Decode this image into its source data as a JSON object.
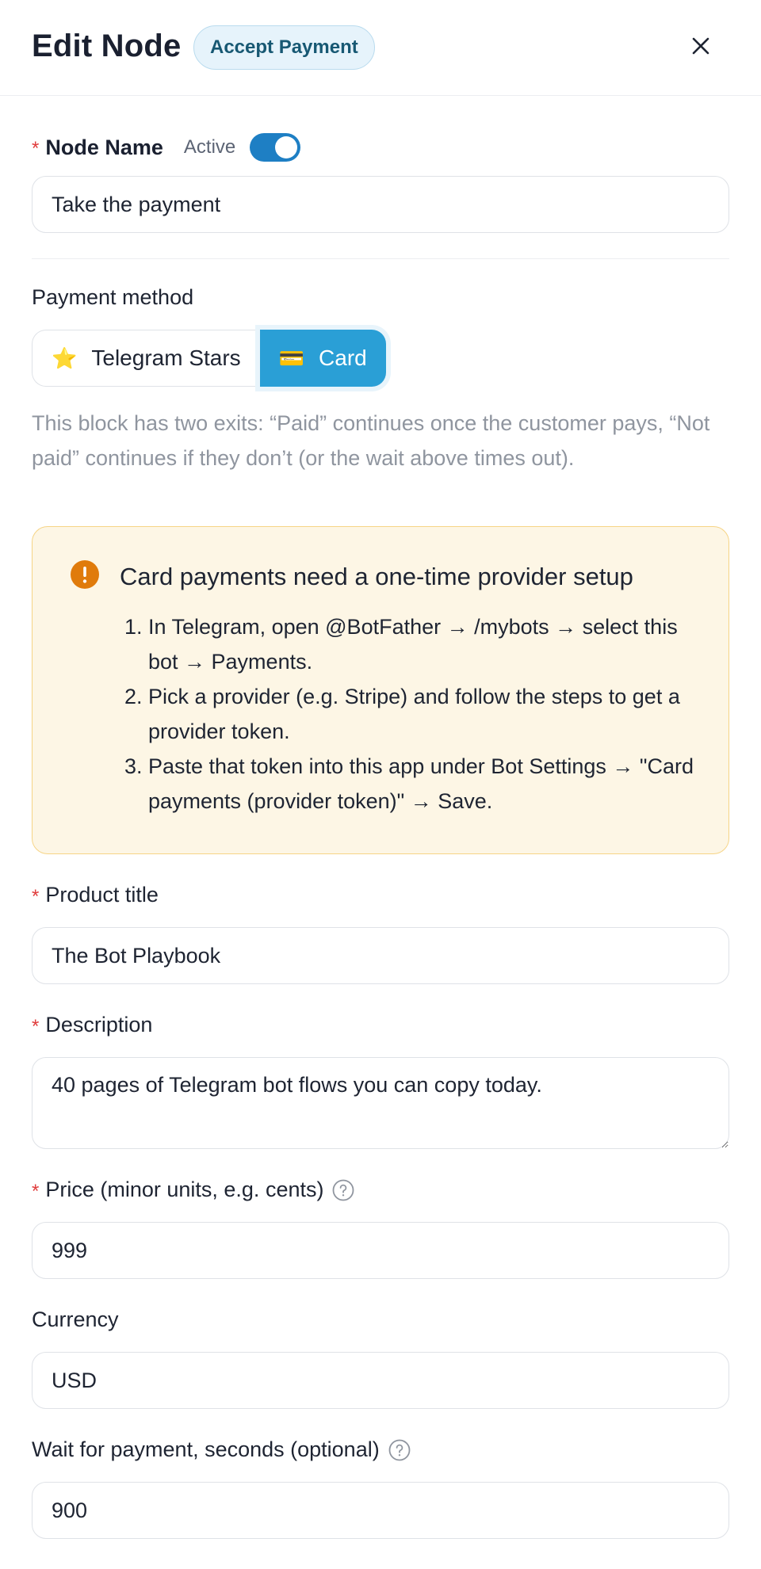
{
  "header": {
    "title": "Edit Node",
    "badge": "Accept Payment"
  },
  "node_name": {
    "label": "Node Name",
    "active_label": "Active",
    "active": true,
    "value": "Take the payment"
  },
  "payment_method": {
    "label": "Payment method",
    "options": [
      {
        "icon": "⭐",
        "label": "Telegram Stars",
        "selected": false
      },
      {
        "icon": "💳",
        "label": "Card",
        "selected": true
      }
    ],
    "hint": "This block has two exits: “Paid” continues once the customer pays, “Not paid” continues if they don’t (or the wait above times out)."
  },
  "alert": {
    "title": "Card payments need a one-time provider setup",
    "steps": [
      "In Telegram, open @BotFather → /mybots → select this bot → Payments.",
      "Pick a provider (e.g. Stripe) and follow the steps to get a provider token.",
      "Paste that token into this app under Bot Settings → \"Card payments (provider token)\" → Save."
    ]
  },
  "product_title": {
    "label": "Product title",
    "value": "The Bot Playbook"
  },
  "description": {
    "label": "Description",
    "value": "40 pages of Telegram bot flows you can copy today."
  },
  "price": {
    "label": "Price (minor units, e.g. cents)",
    "value": "999"
  },
  "currency": {
    "label": "Currency",
    "value": "USD"
  },
  "wait": {
    "label": "Wait for payment, seconds (optional)",
    "value": "900"
  },
  "colors": {
    "accent": "#2a9fd6",
    "toggle": "#1e7fc4",
    "required": "#e03c3c",
    "alert_bg": "#fdf6e5",
    "alert_border": "#f6d486",
    "alert_icon": "#e07b0b"
  }
}
